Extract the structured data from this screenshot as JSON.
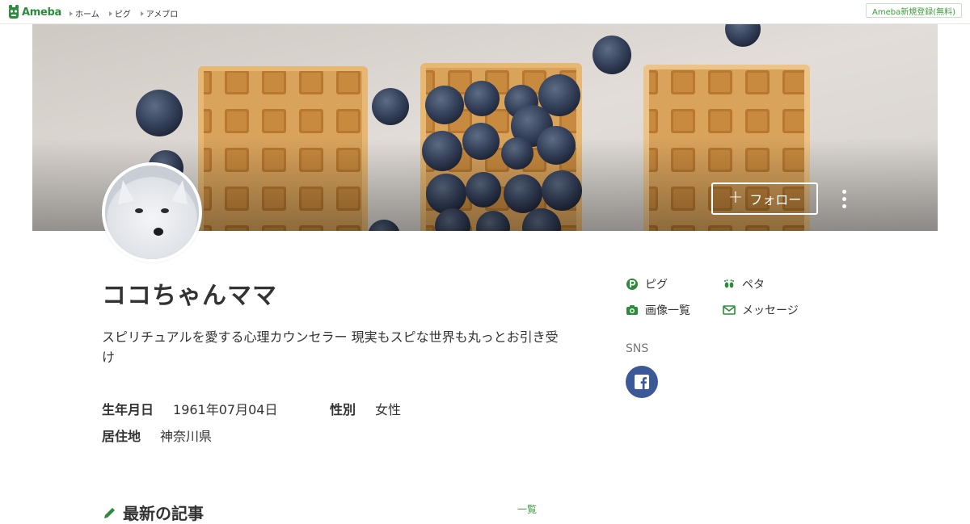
{
  "header": {
    "logo_text": "Ameba",
    "nav": [
      {
        "label": "ホーム"
      },
      {
        "label": "ピグ"
      },
      {
        "label": "アメブロ"
      }
    ],
    "signup_label": "Ameba新規登録(無料)"
  },
  "cover": {
    "follow_label": "フォロー",
    "follow_icon": "plus-icon",
    "more_icon": "vertical-dots-icon"
  },
  "profile": {
    "name": "ココちゃんママ",
    "bio": "スピリチュアルを愛する心理カウンセラー 現実もスピな世界も丸っとお引き受け",
    "birthday_label": "生年月日",
    "birthday_value": "1961年07月04日",
    "gender_label": "性別",
    "gender_value": "女性",
    "residence_label": "居住地",
    "residence_value": "神奈川県"
  },
  "side": {
    "links": [
      {
        "label": "ピグ",
        "icon": "pigg-icon"
      },
      {
        "label": "ペタ",
        "icon": "footprints-icon"
      },
      {
        "label": "画像一覧",
        "icon": "camera-icon"
      },
      {
        "label": "メッセージ",
        "icon": "envelope-icon"
      }
    ],
    "sns_label": "SNS",
    "sns_icon": "facebook-icon"
  },
  "latest": {
    "title": "最新の記事",
    "more_label": "一覧"
  },
  "colors": {
    "brand_green": "#2d8c3c",
    "facebook_blue": "#3b5998"
  }
}
